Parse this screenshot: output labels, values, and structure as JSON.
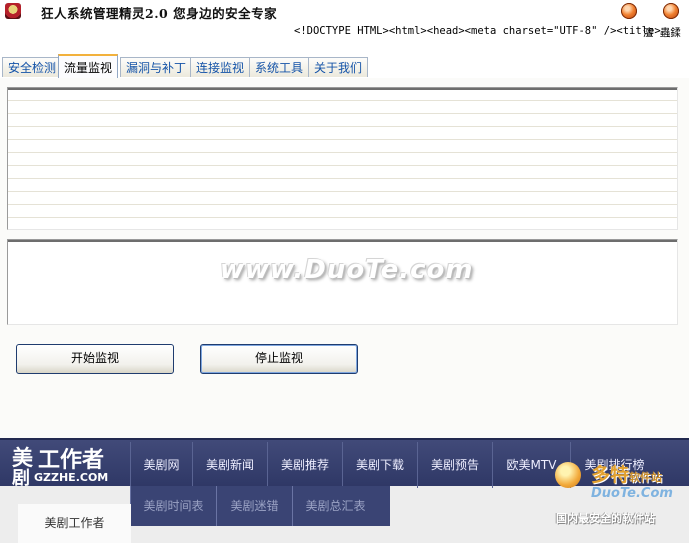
{
  "window": {
    "title": "狂人系统管理精灵2.0  您身边的安全专家",
    "html_strip_left": "<!DOCTYPE HTML><html><head><meta charset=\"UTF-8\" /><title>",
    "html_strip_right": "澶   蟲鍒"
  },
  "tabs": [
    {
      "label": "安全检测",
      "active": false
    },
    {
      "label": "流量监视",
      "active": true
    },
    {
      "label": "漏洞与补丁",
      "active": false
    },
    {
      "label": "连接监视",
      "active": false
    },
    {
      "label": "系统工具",
      "active": false
    },
    {
      "label": "关于我们",
      "active": false
    }
  ],
  "buttons": {
    "start": "开始监视",
    "stop": "停止监视"
  },
  "watermark": "www.DuoTe.com",
  "banner": {
    "logo_top": "工作者",
    "logo_char1": "美",
    "logo_char2": "剧",
    "logo_sub": "GZZHE.COM",
    "nav": [
      "美剧网",
      "美剧新闻",
      "美剧推荐",
      "美剧下载",
      "美剧预告",
      "欧美MTV",
      "美剧排行榜"
    ],
    "subnav": [
      "美剧时间表",
      "美剧迷错",
      "美剧总汇表"
    ],
    "crumb": "美剧工作者"
  },
  "brand": {
    "name_cn": "多特",
    "name_cn_small": "软件站",
    "name_en": "DuoTe.Com",
    "slogan": "国内最安全的软件站"
  },
  "colors": {
    "tab_text": "#1453a8",
    "active_tab_accent": "#f2b13c",
    "banner_nav": "#3a4474"
  }
}
